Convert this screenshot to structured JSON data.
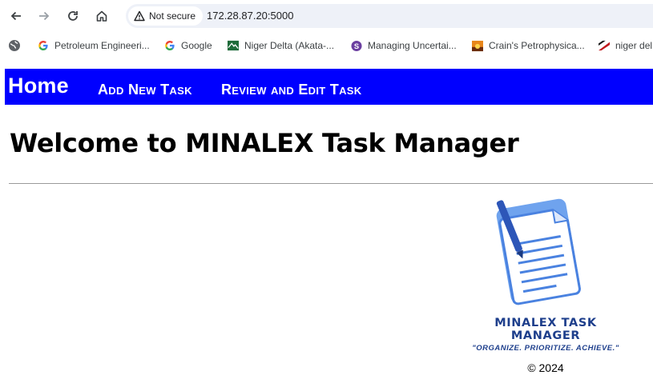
{
  "browser": {
    "security_label": "Not secure",
    "url": "172.28.87.20:5000",
    "bookmarks": [
      {
        "label": "Petroleum Engineeri...",
        "icon": "google-g-icon"
      },
      {
        "label": "Google",
        "icon": "google-g-icon"
      },
      {
        "label": "Niger Delta (Akata-...",
        "icon": "site-icon"
      },
      {
        "label": "Managing Uncertai...",
        "icon": "purple-s-icon"
      },
      {
        "label": "Crain's Petrophysica...",
        "icon": "sunset-icon"
      },
      {
        "label": "niger del",
        "icon": "flag-icon"
      }
    ]
  },
  "navbar": {
    "home": "Home",
    "add_task": "Add New Task",
    "review_task": "Review and Edit Task",
    "bg_color": "#0000ff"
  },
  "main": {
    "title": "Welcome to MINALEX Task Manager"
  },
  "logo": {
    "name": "MINALEX TASK MANAGER",
    "tagline": "\"ORGANIZE. PRIORITIZE. ACHIEVE.\""
  },
  "footer": {
    "copyright": "© 2024"
  }
}
